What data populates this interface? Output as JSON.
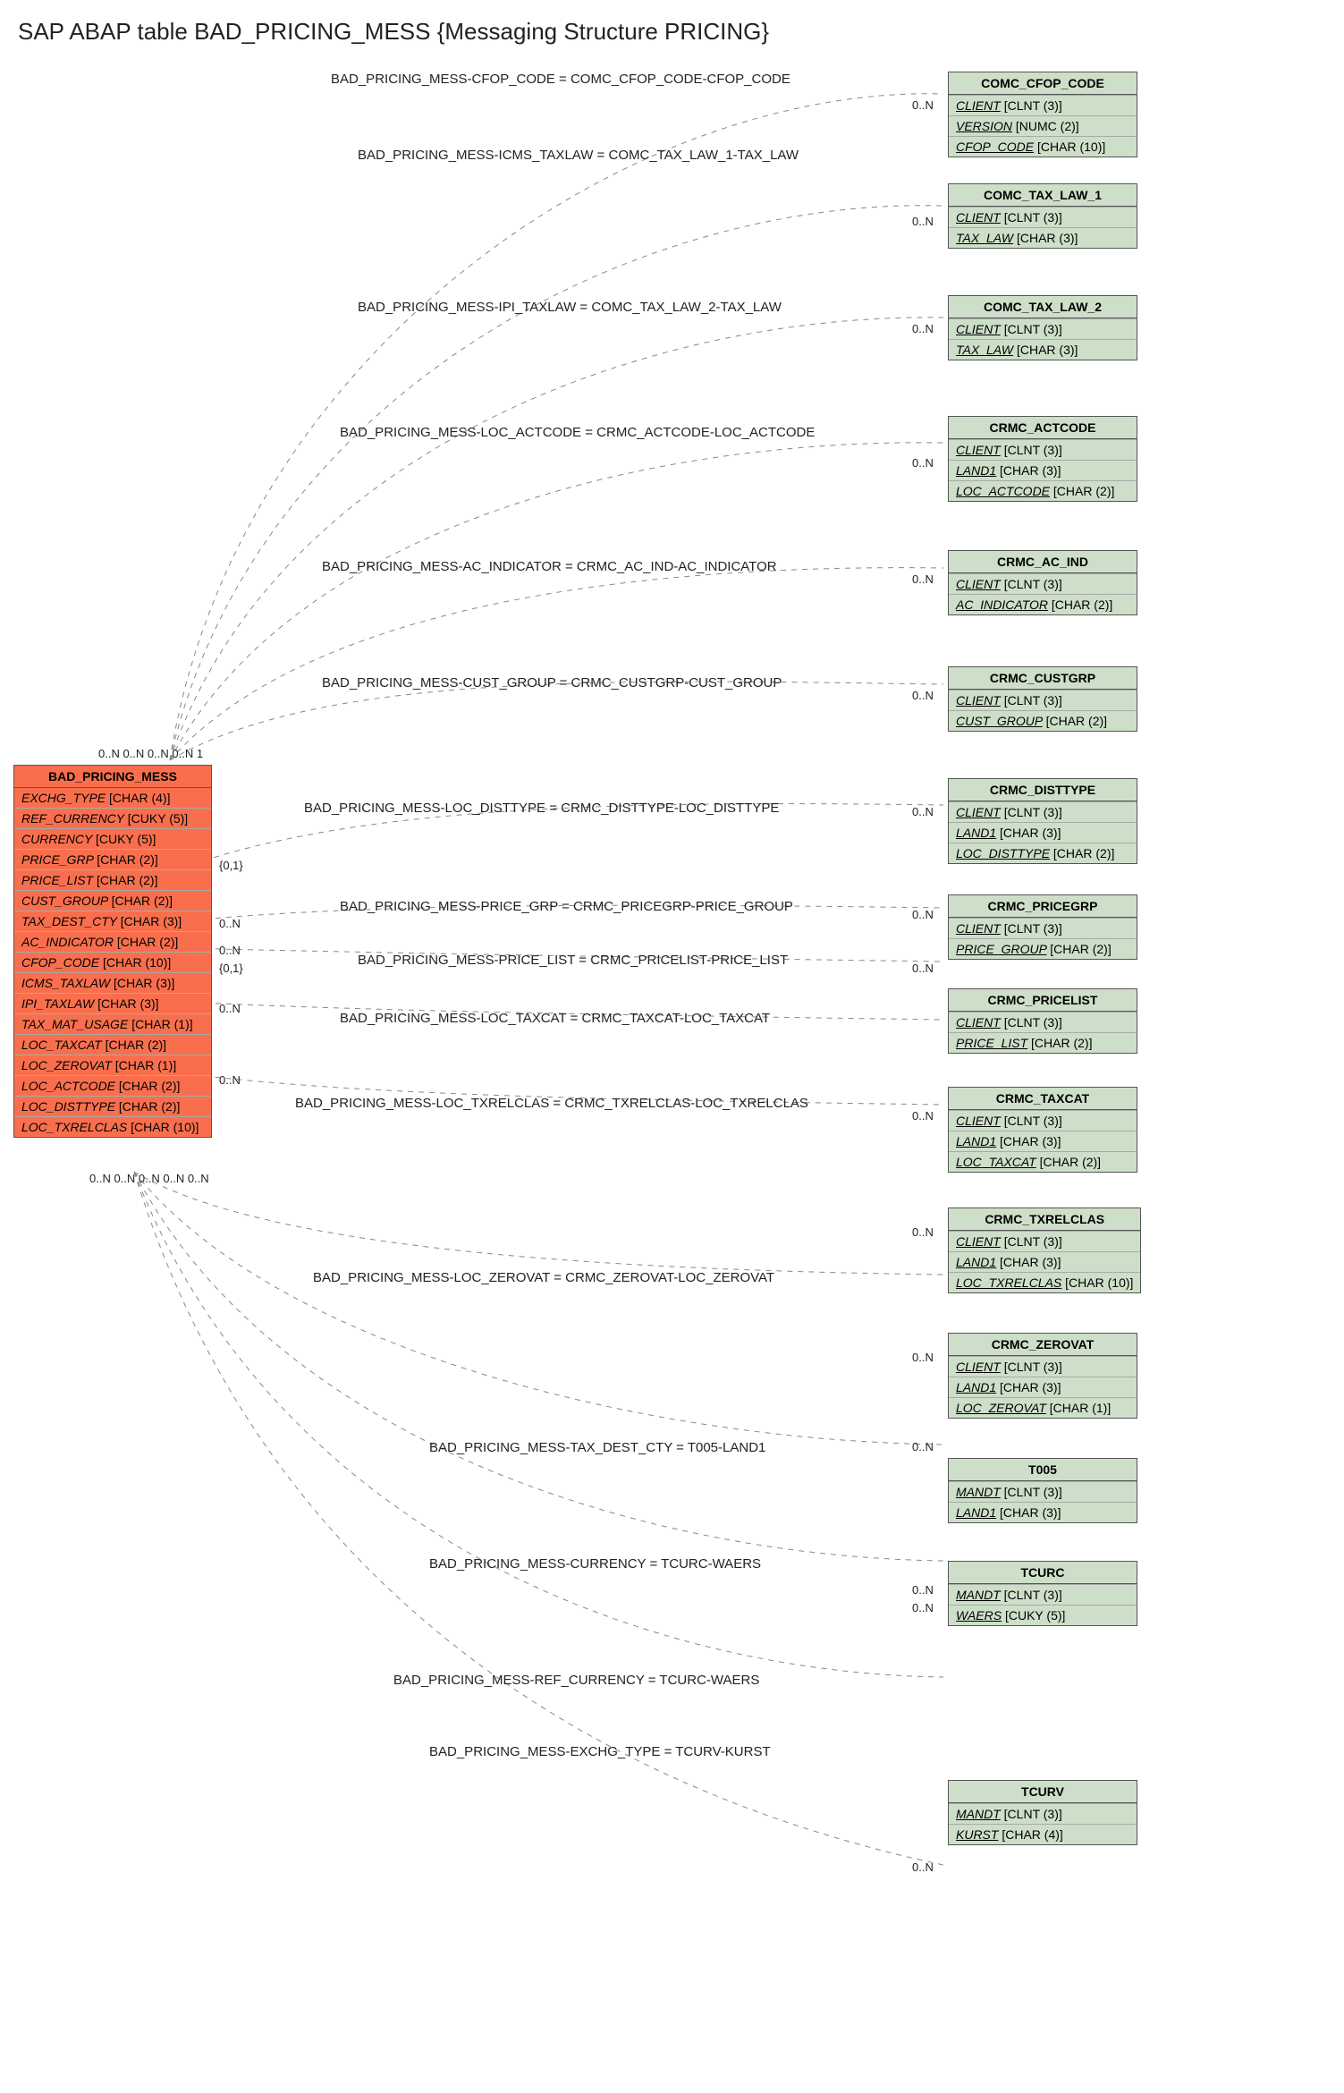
{
  "title": "SAP ABAP table BAD_PRICING_MESS {Messaging Structure PRICING}",
  "main": {
    "name": "BAD_PRICING_MESS",
    "fields": [
      "EXCHG_TYPE [CHAR (4)]",
      "REF_CURRENCY [CUKY (5)]",
      "CURRENCY [CUKY (5)]",
      "PRICE_GRP [CHAR (2)]",
      "PRICE_LIST [CHAR (2)]",
      "CUST_GROUP [CHAR (2)]",
      "TAX_DEST_CTY [CHAR (3)]",
      "AC_INDICATOR [CHAR (2)]",
      "CFOP_CODE [CHAR (10)]",
      "ICMS_TAXLAW [CHAR (3)]",
      "IPI_TAXLAW [CHAR (3)]",
      "TAX_MAT_USAGE [CHAR (1)]",
      "LOC_TAXCAT [CHAR (2)]",
      "LOC_ZEROVAT [CHAR (1)]",
      "LOC_ACTCODE [CHAR (2)]",
      "LOC_DISTTYPE [CHAR (2)]",
      "LOC_TXRELCLAS [CHAR (10)]"
    ]
  },
  "refs": [
    {
      "name": "COMC_CFOP_CODE",
      "fields": [
        "CLIENT [CLNT (3)]",
        "VERSION [NUMC (2)]",
        "CFOP_CODE [CHAR (10)]"
      ],
      "underline": [
        0,
        1,
        2
      ]
    },
    {
      "name": "COMC_TAX_LAW_1",
      "fields": [
        "CLIENT [CLNT (3)]",
        "TAX_LAW [CHAR (3)]"
      ],
      "underline": [
        0,
        1
      ]
    },
    {
      "name": "COMC_TAX_LAW_2",
      "fields": [
        "CLIENT [CLNT (3)]",
        "TAX_LAW [CHAR (3)]"
      ],
      "underline": [
        0,
        1
      ]
    },
    {
      "name": "CRMC_ACTCODE",
      "fields": [
        "CLIENT [CLNT (3)]",
        "LAND1 [CHAR (3)]",
        "LOC_ACTCODE [CHAR (2)]"
      ],
      "underline": [
        0,
        1,
        2
      ]
    },
    {
      "name": "CRMC_AC_IND",
      "fields": [
        "CLIENT [CLNT (3)]",
        "AC_INDICATOR [CHAR (2)]"
      ],
      "underline": [
        0,
        1
      ]
    },
    {
      "name": "CRMC_CUSTGRP",
      "fields": [
        "CLIENT [CLNT (3)]",
        "CUST_GROUP [CHAR (2)]"
      ],
      "underline": [
        0,
        1
      ]
    },
    {
      "name": "CRMC_DISTTYPE",
      "fields": [
        "CLIENT [CLNT (3)]",
        "LAND1 [CHAR (3)]",
        "LOC_DISTTYPE [CHAR (2)]"
      ],
      "underline": [
        0,
        1,
        2
      ]
    },
    {
      "name": "CRMC_PRICEGRP",
      "fields": [
        "CLIENT [CLNT (3)]",
        "PRICE_GROUP [CHAR (2)]"
      ],
      "underline": [
        0,
        1
      ]
    },
    {
      "name": "CRMC_PRICELIST",
      "fields": [
        "CLIENT [CLNT (3)]",
        "PRICE_LIST [CHAR (2)]"
      ],
      "underline": [
        0,
        1
      ]
    },
    {
      "name": "CRMC_TAXCAT",
      "fields": [
        "CLIENT [CLNT (3)]",
        "LAND1 [CHAR (3)]",
        "LOC_TAXCAT [CHAR (2)]"
      ],
      "underline": [
        0,
        1,
        2
      ]
    },
    {
      "name": "CRMC_TXRELCLAS",
      "fields": [
        "CLIENT [CLNT (3)]",
        "LAND1 [CHAR (3)]",
        "LOC_TXRELCLAS [CHAR (10)]"
      ],
      "underline": [
        0,
        1,
        2
      ]
    },
    {
      "name": "CRMC_ZEROVAT",
      "fields": [
        "CLIENT [CLNT (3)]",
        "LAND1 [CHAR (3)]",
        "LOC_ZEROVAT [CHAR (1)]"
      ],
      "underline": [
        0,
        1,
        2
      ]
    },
    {
      "name": "T005",
      "fields": [
        "MANDT [CLNT (3)]",
        "LAND1 [CHAR (3)]"
      ],
      "underline": [
        0,
        1
      ]
    },
    {
      "name": "TCURC",
      "fields": [
        "MANDT [CLNT (3)]",
        "WAERS [CUKY (5)]"
      ],
      "underline": [
        0,
        1
      ]
    },
    {
      "name": "TCURV",
      "fields": [
        "MANDT [CLNT (3)]",
        "KURST [CHAR (4)]"
      ],
      "underline": [
        0,
        1
      ]
    }
  ],
  "rels": [
    {
      "label": "BAD_PRICING_MESS-CFOP_CODE = COMC_CFOP_CODE-CFOP_CODE",
      "card_r": "0..N"
    },
    {
      "label": "BAD_PRICING_MESS-ICMS_TAXLAW = COMC_TAX_LAW_1-TAX_LAW",
      "card_r": "0..N"
    },
    {
      "label": "BAD_PRICING_MESS-IPI_TAXLAW = COMC_TAX_LAW_2-TAX_LAW",
      "card_r": "0..N"
    },
    {
      "label": "BAD_PRICING_MESS-LOC_ACTCODE = CRMC_ACTCODE-LOC_ACTCODE",
      "card_r": "0..N"
    },
    {
      "label": "BAD_PRICING_MESS-AC_INDICATOR = CRMC_AC_IND-AC_INDICATOR",
      "card_r": "0..N"
    },
    {
      "label": "BAD_PRICING_MESS-CUST_GROUP = CRMC_CUSTGRP-CUST_GROUP",
      "card_r": "0..N"
    },
    {
      "label": "BAD_PRICING_MESS-LOC_DISTTYPE = CRMC_DISTTYPE-LOC_DISTTYPE",
      "card_r": "0..N"
    },
    {
      "label": "BAD_PRICING_MESS-PRICE_GRP = CRMC_PRICEGRP-PRICE_GROUP",
      "card_r": "0..N"
    },
    {
      "label": "BAD_PRICING_MESS-PRICE_LIST = CRMC_PRICELIST-PRICE_LIST",
      "card_r": "0..N"
    },
    {
      "label": "BAD_PRICING_MESS-LOC_TAXCAT = CRMC_TAXCAT-LOC_TAXCAT",
      "card_r": "0..N"
    },
    {
      "label": "BAD_PRICING_MESS-LOC_TXRELCLAS = CRMC_TXRELCLAS-LOC_TXRELCLAS",
      "card_r": "0..N"
    },
    {
      "label": "BAD_PRICING_MESS-LOC_ZEROVAT = CRMC_ZEROVAT-LOC_ZEROVAT",
      "card_r": "0..N"
    },
    {
      "label": "BAD_PRICING_MESS-TAX_DEST_CTY = T005-LAND1",
      "card_r": "0..N"
    },
    {
      "label": "BAD_PRICING_MESS-CURRENCY = TCURC-WAERS",
      "card_r": "0..N"
    },
    {
      "label": "BAD_PRICING_MESS-REF_CURRENCY = TCURC-WAERS",
      "card_r": "0..N"
    },
    {
      "label": "BAD_PRICING_MESS-EXCHG_TYPE = TCURV-KURST",
      "card_r": "0..N"
    }
  ],
  "left_cards_top": "0..N 0..N 0..N 0..N 1",
  "left_cards_mid": [
    "{0,1}",
    "0..N",
    "0..N",
    "{0,1}",
    "0..N",
    "0..N"
  ],
  "left_cards_bot": "0..N 0..N 0..N 0..N 0..N"
}
